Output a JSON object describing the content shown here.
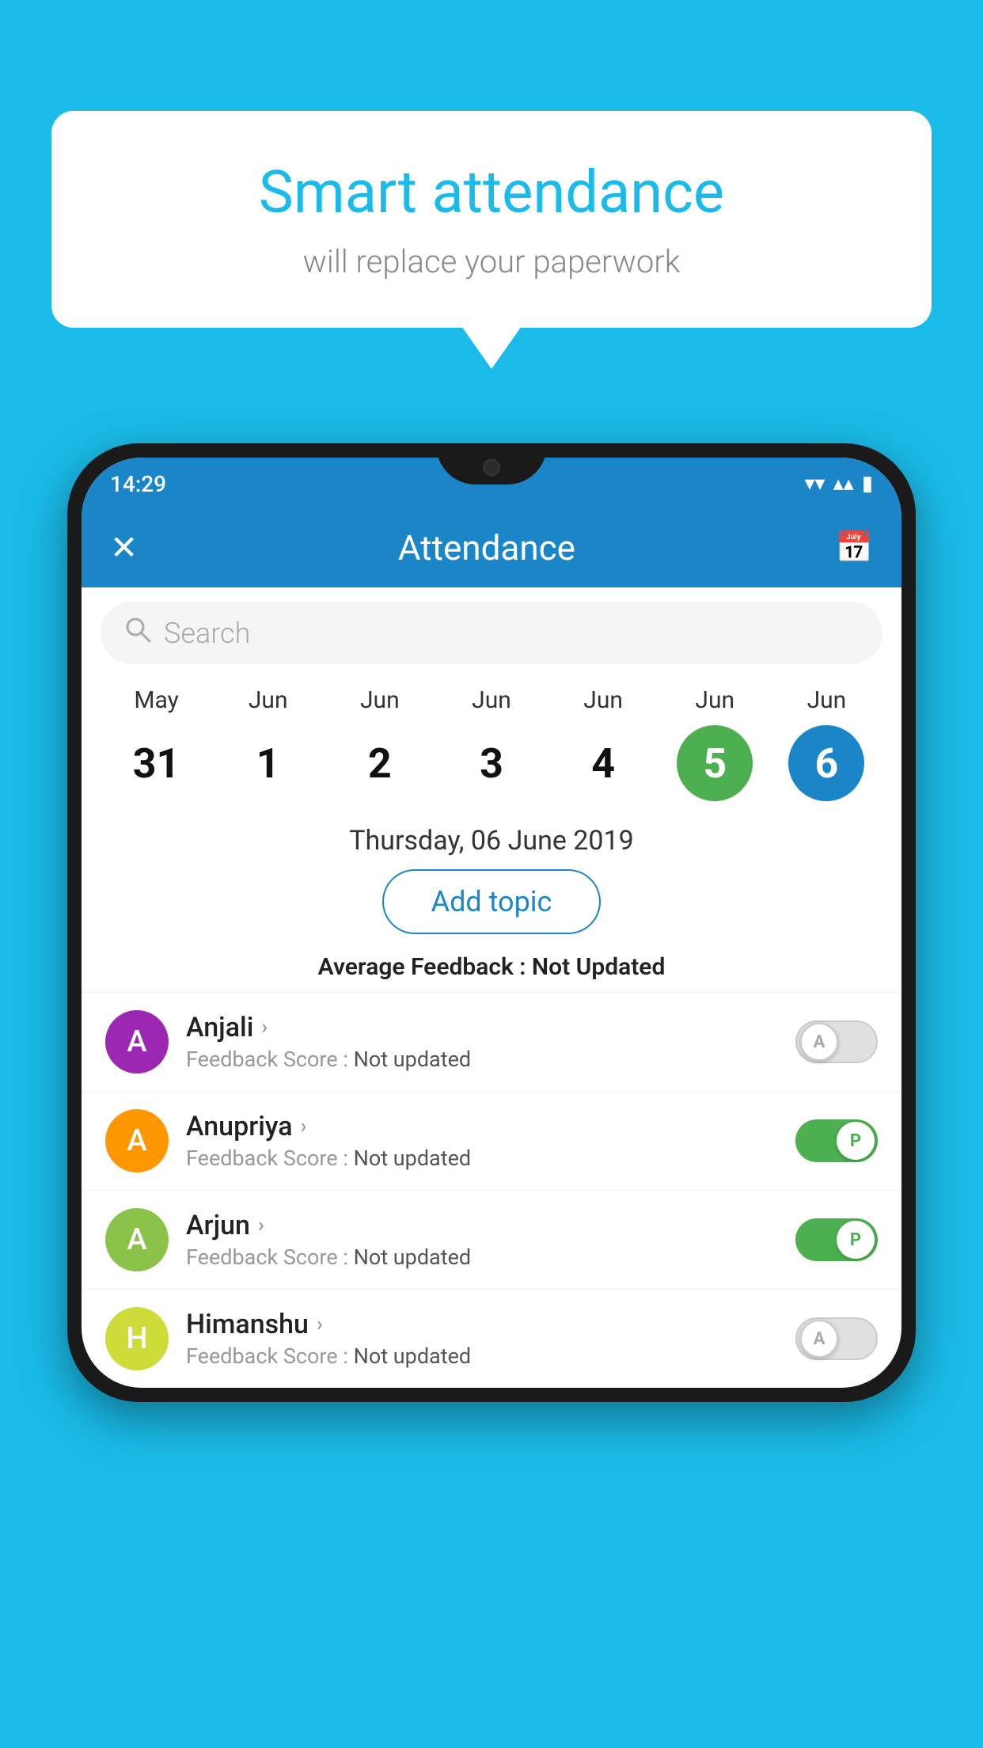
{
  "background_color": "#1ABBE8",
  "bubble": {
    "title": "Smart attendance",
    "subtitle": "will replace your paperwork"
  },
  "status_bar": {
    "time": "14:29",
    "wifi": "▾",
    "signal": "▴",
    "battery": "▮"
  },
  "header": {
    "title": "Attendance",
    "close_label": "✕",
    "calendar_icon": "📅"
  },
  "search": {
    "placeholder": "Search"
  },
  "calendar": {
    "days": [
      {
        "month": "May",
        "date": "31",
        "state": "normal"
      },
      {
        "month": "Jun",
        "date": "1",
        "state": "normal"
      },
      {
        "month": "Jun",
        "date": "2",
        "state": "normal"
      },
      {
        "month": "Jun",
        "date": "3",
        "state": "normal"
      },
      {
        "month": "Jun",
        "date": "4",
        "state": "normal"
      },
      {
        "month": "Jun",
        "date": "5",
        "state": "today"
      },
      {
        "month": "Jun",
        "date": "6",
        "state": "selected"
      }
    ]
  },
  "selected_date": "Thursday, 06 June 2019",
  "add_topic_label": "Add topic",
  "avg_feedback_label": "Average Feedback :",
  "avg_feedback_value": "Not Updated",
  "students": [
    {
      "name": "Anjali",
      "avatar_letter": "A",
      "avatar_color": "purple",
      "feedback_label": "Feedback Score :",
      "feedback_value": "Not updated",
      "toggle_state": "off",
      "toggle_label": "A"
    },
    {
      "name": "Anupriya",
      "avatar_letter": "A",
      "avatar_color": "orange",
      "feedback_label": "Feedback Score :",
      "feedback_value": "Not updated",
      "toggle_state": "on",
      "toggle_label": "P"
    },
    {
      "name": "Arjun",
      "avatar_letter": "A",
      "avatar_color": "green",
      "feedback_label": "Feedback Score :",
      "feedback_value": "Not updated",
      "toggle_state": "on",
      "toggle_label": "P"
    },
    {
      "name": "Himanshu",
      "avatar_letter": "H",
      "avatar_color": "lime",
      "feedback_label": "Feedback Score :",
      "feedback_value": "Not updated",
      "toggle_state": "off",
      "toggle_label": "A"
    }
  ]
}
